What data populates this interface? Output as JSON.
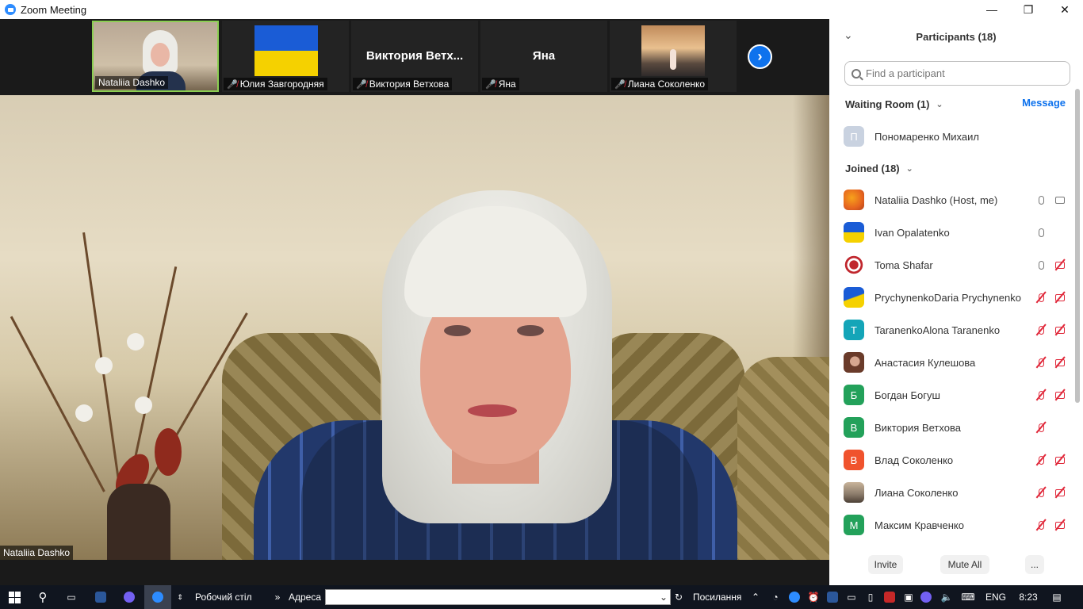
{
  "window": {
    "title": "Zoom Meeting",
    "minimize": "—",
    "restore": "❐",
    "close": "✕"
  },
  "strip": {
    "thumbs": [
      {
        "name": "Nataliia Dashko",
        "muted": false
      },
      {
        "name": "Юлия Завгородняя",
        "muted": true
      },
      {
        "name": "Виктория Ветхова",
        "muted": true,
        "big_label": "Виктория  Ветх..."
      },
      {
        "name": "Яна",
        "muted": true,
        "big_label": "Яна"
      },
      {
        "name": "Лиана Соколенко",
        "muted": true
      }
    ],
    "next_icon": "›"
  },
  "main_video": {
    "name": "Nataliia Dashko"
  },
  "panel": {
    "title": "Participants (18)",
    "collapse_icon": "⌄",
    "search_placeholder": "Find a participant",
    "waiting_room": {
      "label": "Waiting Room (1)",
      "message": "Message",
      "people": [
        {
          "name": "Пономаренко Михаил",
          "initial": "П",
          "color": "#c9d2e0"
        }
      ]
    },
    "joined": {
      "label": "Joined (18)",
      "people": [
        {
          "name": "Nataliia Dashko (Host, me)",
          "avatar": "image-orange",
          "mic": "on",
          "cam": "on"
        },
        {
          "name": "Ivan Opalatenko",
          "avatar": "flag-ua",
          "mic": "on",
          "cam": "none"
        },
        {
          "name": "Toma Shafar",
          "avatar": "ornament",
          "mic": "on",
          "cam": "off"
        },
        {
          "name": "PrychynenkoDaria Prychynenko",
          "avatar": "flag-ua-wave",
          "mic": "off",
          "cam": "off"
        },
        {
          "name": "TaranenkoAlona Taranenko",
          "initial": "T",
          "color": "#14a5b8",
          "mic": "off",
          "cam": "off"
        },
        {
          "name": "Анастасия Кулешова",
          "avatar": "photo-brown",
          "mic": "off",
          "cam": "off"
        },
        {
          "name": "Богдан Богуш",
          "initial": "Б",
          "color": "#23a15a",
          "mic": "off",
          "cam": "off"
        },
        {
          "name": "Виктория Ветхова",
          "initial": "В",
          "color": "#23a15a",
          "mic": "off",
          "cam": "none"
        },
        {
          "name": "Влад Соколенко",
          "initial": "В",
          "color": "#f0532d",
          "mic": "off",
          "cam": "off"
        },
        {
          "name": "Лиана Соколенко",
          "avatar": "photo-city",
          "mic": "off",
          "cam": "off"
        },
        {
          "name": "Максим Кравченко",
          "initial": "М",
          "color": "#23a15a",
          "mic": "off",
          "cam": "off"
        }
      ]
    },
    "footer": {
      "invite": "Invite",
      "mute_all": "Mute All",
      "more": "..."
    }
  },
  "taskbar": {
    "desktop_label": "Робочий стіл",
    "address_label": "Адреса",
    "links_label": "Посилання",
    "lang": "ENG",
    "time": "8:23"
  },
  "colors": {
    "accent": "#0e72ed",
    "muted_red": "#e0283a",
    "taskbar": "#10151f"
  }
}
